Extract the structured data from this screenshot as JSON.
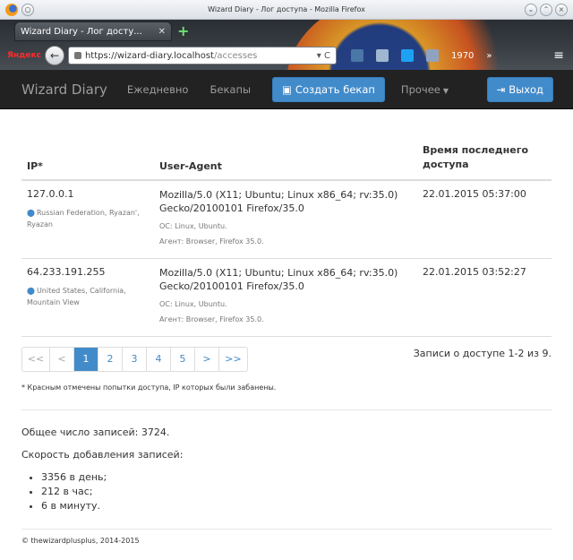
{
  "window": {
    "title": "Wizard Diary - Лог доступа - Mozilla Firefox"
  },
  "browser": {
    "tab_title": "Wizard Diary - Лог досту...",
    "yandex_label": "Яндекс",
    "url_host": "https://wizard-diary.localhost",
    "url_path": "/accesses",
    "counter": "1970"
  },
  "navbar": {
    "brand": "Wizard Diary",
    "links": [
      "Ежедневно",
      "Бекапы"
    ],
    "create_backup": "Создать бекап",
    "more": "Прочее",
    "logout": "Выход"
  },
  "table": {
    "headers": [
      "IP*",
      "User-Agent",
      "Время последнего доступа"
    ],
    "rows": [
      {
        "ip": "127.0.0.1",
        "location": "Russian Federation, Ryazan', Ryazan",
        "ua": "Mozilla/5.0 (X11; Ubuntu; Linux x86_64; rv:35.0) Gecko/20100101 Firefox/35.0",
        "os": "ОС: Linux, Ubuntu.",
        "agent": "Агент: Browser, Firefox 35.0.",
        "time": "22.01.2015 05:37:00"
      },
      {
        "ip": "64.233.191.255",
        "location": "United States, California, Mountain View",
        "ua": "Mozilla/5.0 (X11; Ubuntu; Linux x86_64; rv:35.0) Gecko/20100101 Firefox/35.0",
        "os": "ОС: Linux, Ubuntu.",
        "agent": "Агент: Browser, Firefox 35.0.",
        "time": "22.01.2015 03:52:27"
      }
    ]
  },
  "pagination": {
    "items": [
      "<<",
      "<",
      "1",
      "2",
      "3",
      "4",
      "5",
      ">",
      ">>"
    ],
    "active": "1",
    "summary": "Записи о доступе 1-2 из 9."
  },
  "footnote": "* Красным отмечены попытки доступа, IP которых были забанены.",
  "stats": {
    "total": "Общее число записей: 3724.",
    "rate_title": "Скорость добавления записей:",
    "rates": [
      "3356 в день;",
      "212 в час;",
      "6 в минуту."
    ]
  },
  "copyright": "© thewizardplusplus, 2014-2015",
  "colors": {
    "primary": "#428bca",
    "navbar": "#222222"
  }
}
